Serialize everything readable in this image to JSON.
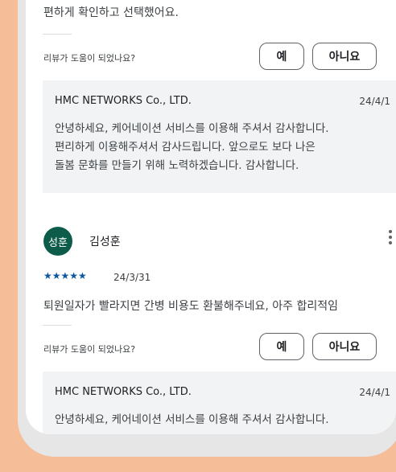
{
  "review1": {
    "body_tail": "편하게 확인하고 선택했어요.",
    "helpful_question": "리뷰가 도움이 되었나요?",
    "yes_label": "예",
    "no_label": "아니요",
    "reply": {
      "developer": "HMC NETWORKS Co., LTD.",
      "date": "24/4/1",
      "text": "안녕하세요, 케어네이션 서비스를 이용해 주셔서 감사합니다.\n편리하게 이용해주셔서 감사드립니다. 앞으로도 보다 나은\n돌봄 문화를 만들기 위해 노력하겠습니다. 감사합니다."
    }
  },
  "review2": {
    "avatar_text": "성훈",
    "author": "김성훈",
    "rating": 5,
    "stars": "★★★★★",
    "date": "24/3/31",
    "body": "퇴원일자가 빨라지면 간병 비용도 환불해주네요, 아주 합리적임",
    "helpful_question": "리뷰가 도움이 되었나요?",
    "yes_label": "예",
    "no_label": "아니요",
    "reply": {
      "developer": "HMC NETWORKS Co., LTD.",
      "date": "24/4/1",
      "text": "안녕하세요, 케어네이션 서비스를 이용해 주셔서 감사합니다."
    }
  },
  "colors": {
    "background": "#f5bd98",
    "avatar": "#0d5c4a",
    "star": "#0b57a0",
    "reply_bg": "#f1f3f4"
  }
}
